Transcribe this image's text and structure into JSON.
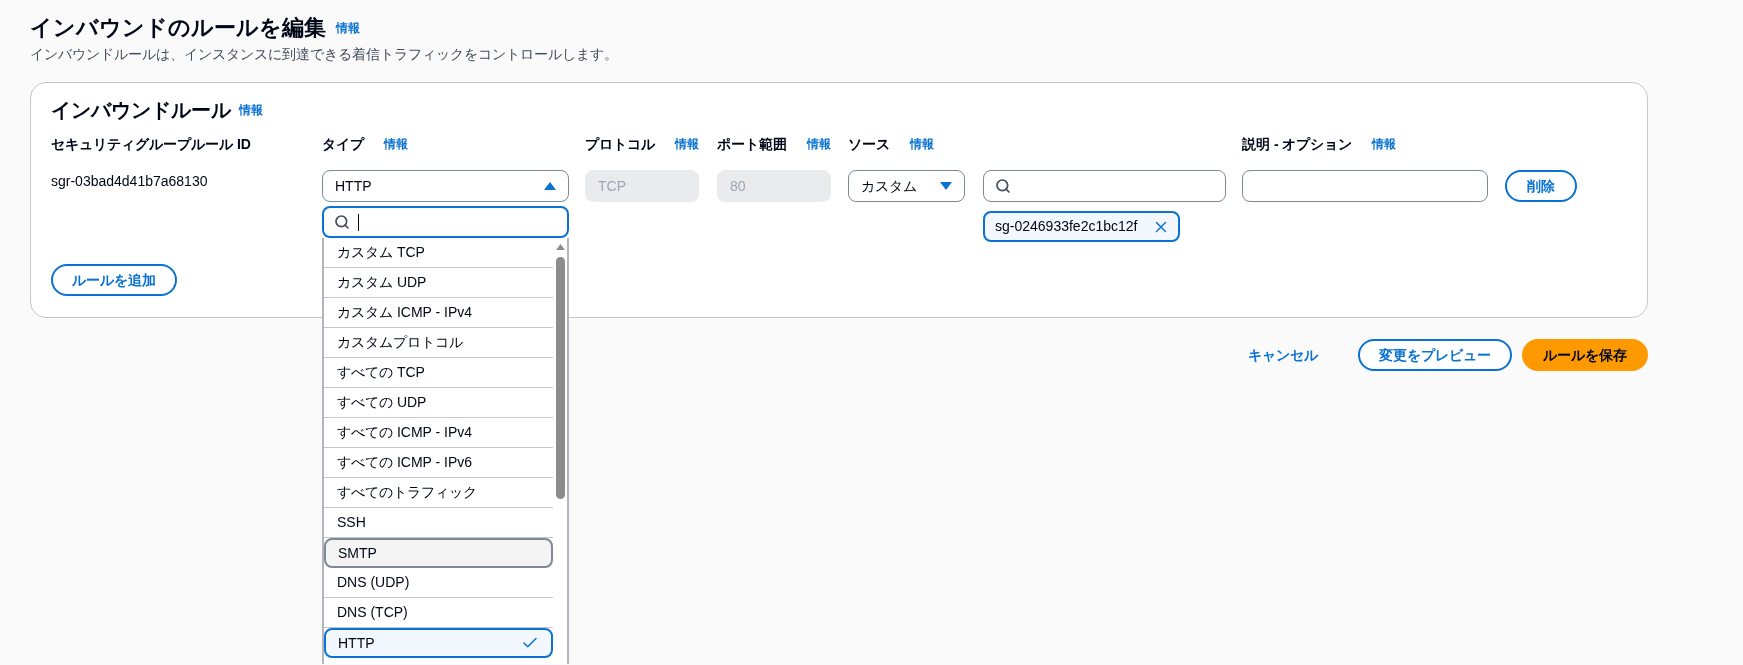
{
  "page": {
    "title": "インバウンドのルールを編集",
    "info_link": "情報",
    "description": "インバウンドルールは、インスタンスに到達できる着信トラフィックをコントロールします。"
  },
  "inbound_rules": {
    "heading": "インバウンドルール",
    "info_link": "情報",
    "columns": [
      {
        "label": "セキュリティグループルール ID"
      },
      {
        "label": "タイプ",
        "info_link": "情報"
      },
      {
        "label": "プロトコル",
        "info_link": "情報"
      },
      {
        "label": "ポート範囲",
        "info_link": "情報"
      },
      {
        "label": "ソース",
        "info_link": "情報"
      },
      {
        "label": "説明 - オプション",
        "info_link": "情報"
      }
    ],
    "rows": [
      {
        "rule_id": "sgr-03bad4d41b7a68130",
        "type": {
          "value": "HTTP",
          "expanded": true
        },
        "protocol": {
          "value": "TCP",
          "disabled": true
        },
        "port_range": {
          "value": "80",
          "disabled": true
        },
        "source": {
          "value": "カスタム",
          "expanded": false
        },
        "source_tokens": [
          {
            "label": "sg-0246933fe2c1bc12f"
          }
        ],
        "delete_button": "削除"
      }
    ],
    "add_rule_button": "ルールを追加"
  },
  "type_dropdown": {
    "filter": {
      "focused": true
    },
    "options": [
      {
        "label": "カスタム TCP",
        "selected": false,
        "highlighted": false
      },
      {
        "label": "カスタム UDP",
        "selected": false,
        "highlighted": false
      },
      {
        "label": "カスタム ICMP - IPv4",
        "selected": false,
        "highlighted": false
      },
      {
        "label": "カスタムプロトコル",
        "selected": false,
        "highlighted": false
      },
      {
        "label": "すべての TCP",
        "selected": false,
        "highlighted": false
      },
      {
        "label": "すべての UDP",
        "selected": false,
        "highlighted": false
      },
      {
        "label": "すべての ICMP - IPv4",
        "selected": false,
        "highlighted": false
      },
      {
        "label": "すべての ICMP - IPv6",
        "selected": false,
        "highlighted": false
      },
      {
        "label": "すべてのトラフィック",
        "selected": false,
        "highlighted": false
      },
      {
        "label": "SSH",
        "selected": false,
        "highlighted": false
      },
      {
        "label": "SMTP",
        "selected": false,
        "highlighted": true
      },
      {
        "label": "DNS (UDP)",
        "selected": false,
        "highlighted": false
      },
      {
        "label": "DNS (TCP)",
        "selected": false,
        "highlighted": false
      },
      {
        "label": "HTTP",
        "selected": true,
        "highlighted": false
      }
    ]
  },
  "actions": [
    {
      "label": "キャンセル",
      "kind": "link"
    },
    {
      "label": "変更をプレビュー",
      "kind": "secondary"
    },
    {
      "label": "ルールを保存",
      "kind": "primary"
    }
  ]
}
